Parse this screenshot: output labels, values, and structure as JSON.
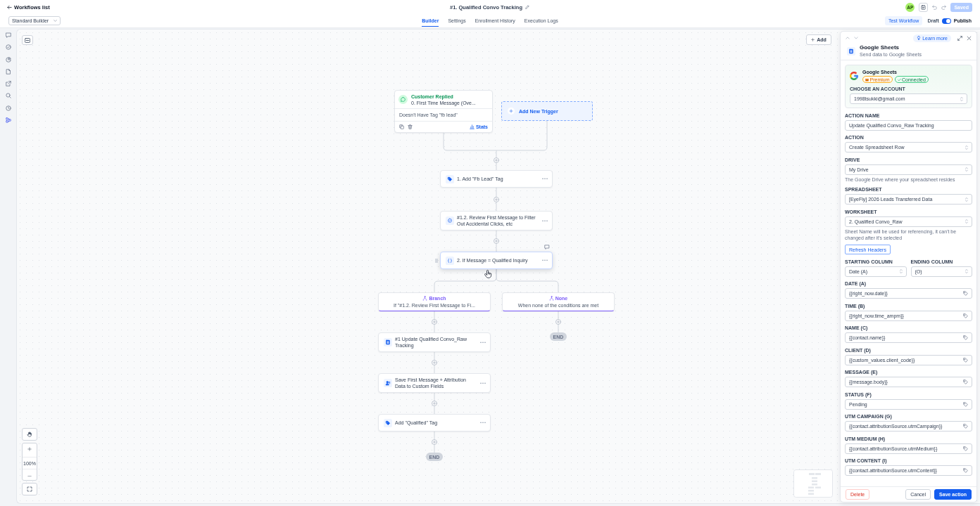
{
  "header": {
    "back_link": "Workflows list",
    "title": "#1. Qualified Convo Tracking",
    "avatar": "AP",
    "save_button": {
      "label": "Saved",
      "disabled": true
    }
  },
  "toolbar": {
    "builder_select": "Standard Builder",
    "tabs": [
      {
        "label": "Builder",
        "selected": true
      },
      {
        "label": "Settings",
        "selected": false
      },
      {
        "label": "Enrollment History",
        "selected": false
      },
      {
        "label": "Execution Logs",
        "selected": false
      }
    ],
    "test_button": "Test Workflow",
    "publish_toggle": {
      "off_label": "Draft",
      "on_label": "Publish",
      "on": true
    }
  },
  "sidebar": {
    "items": [
      {
        "selected": false
      },
      {
        "selected": false
      },
      {
        "selected": false
      },
      {
        "selected": false
      },
      {
        "selected": false
      },
      {
        "selected": false
      },
      {
        "selected": false
      },
      {
        "selected": true
      }
    ]
  },
  "canvas": {
    "add_button": "Add",
    "zoom_level": "100%",
    "trigger": {
      "event": "Customer Replied",
      "name": "0. First Time Message (Ove...",
      "filter": "Doesn't Have Tag \"fb lead\"",
      "stats_button": "Stats"
    },
    "add_trigger": "Add New Trigger",
    "steps": [
      {
        "kind": "tag",
        "label": "1. Add \"Fb Lead\" Tag",
        "hovered": false
      },
      {
        "kind": "ai",
        "label": "#1.2. Review First Message to Filter Out Accidental Clicks, etc",
        "hovered": false
      },
      {
        "kind": "condition",
        "label": "2. If Message = Qualified Inquiry",
        "hovered": true
      }
    ],
    "branches": [
      {
        "title": "Branch",
        "condition": "If \"#1.2. Review First Message to Fi...",
        "steps": [
          {
            "kind": "sheets",
            "label": "#1 Update Qualified Convo_Raw Tracking"
          },
          {
            "kind": "contact",
            "label": "Save First Message + Attribution Data to Custom Fields"
          },
          {
            "kind": "tag",
            "label": "Add \"Qualified\" Tag"
          }
        ],
        "end": "END"
      },
      {
        "title": "None",
        "condition": "When none of the conditions are met",
        "end": "END"
      }
    ]
  },
  "panel": {
    "learn_more": "Learn more",
    "app_name": "Google Sheets",
    "app_description": "Send data to Google Sheets",
    "account": {
      "app_name": "Google Sheets",
      "badges": [
        {
          "kind": "premium",
          "label": "Premium"
        },
        {
          "kind": "connected",
          "label": "Connected"
        }
      ],
      "label": "CHOOSE AN ACCOUNT",
      "value": "1998tsukki@gmail.com"
    },
    "fields": [
      {
        "kind": "text",
        "label": "ACTION NAME",
        "value": "Update Qualified Convo_Raw Tracking"
      },
      {
        "kind": "select",
        "label": "ACTION",
        "value": "Create Spreadsheet Row"
      },
      {
        "kind": "select",
        "label": "DRIVE",
        "value": "My Drive",
        "hint": "The Google Drive where your spreadsheet resides"
      },
      {
        "kind": "select",
        "label": "SPREADSHEET",
        "value": "[EyeFly] 2026 Leads Transferred Data"
      },
      {
        "kind": "select",
        "label": "WORKSHEET",
        "value": "2. Qualified Convo_Raw",
        "hint": "Sheet Name will be used for referencing, it can't be changed after it's selected"
      },
      {
        "kind": "button",
        "label": "Refresh Headers"
      },
      {
        "kind": "pair",
        "items": [
          {
            "label": "STARTING COLUMN",
            "value": "Date (A)"
          },
          {
            "label": "ENDING COLUMN",
            "value": "(O)"
          }
        ]
      },
      {
        "kind": "mapped",
        "label": "DATE (A)",
        "value": "{{right_now.date}}"
      },
      {
        "kind": "mapped",
        "label": "TIME (B)",
        "value": "{{right_now.time_ampm}}"
      },
      {
        "kind": "mapped",
        "label": "NAME (C)",
        "value": "{{contact.name}}"
      },
      {
        "kind": "mapped",
        "label": "CLIENT (D)",
        "value": "{{custom_values.client_code}}"
      },
      {
        "kind": "mapped",
        "label": "MESSAGE (E)",
        "value": "{{message.body}}"
      },
      {
        "kind": "mapped",
        "label": "STATUS (F)",
        "value": "Pending"
      },
      {
        "kind": "mapped",
        "label": "UTM CAMPAIGN (G)",
        "value": "{{contact.attributionSource.utmCampaign}}"
      },
      {
        "kind": "mapped",
        "label": "UTM MEDIUM (H)",
        "value": "{{contact.attributionSource.utmMedium}}"
      },
      {
        "kind": "mapped",
        "label": "UTM CONTENT (I)",
        "value": "{{contact.attributionSource.utmContent}}"
      }
    ],
    "footer": {
      "delete_button": "Delete",
      "cancel_button": "Cancel",
      "save_button": "Save action"
    }
  }
}
